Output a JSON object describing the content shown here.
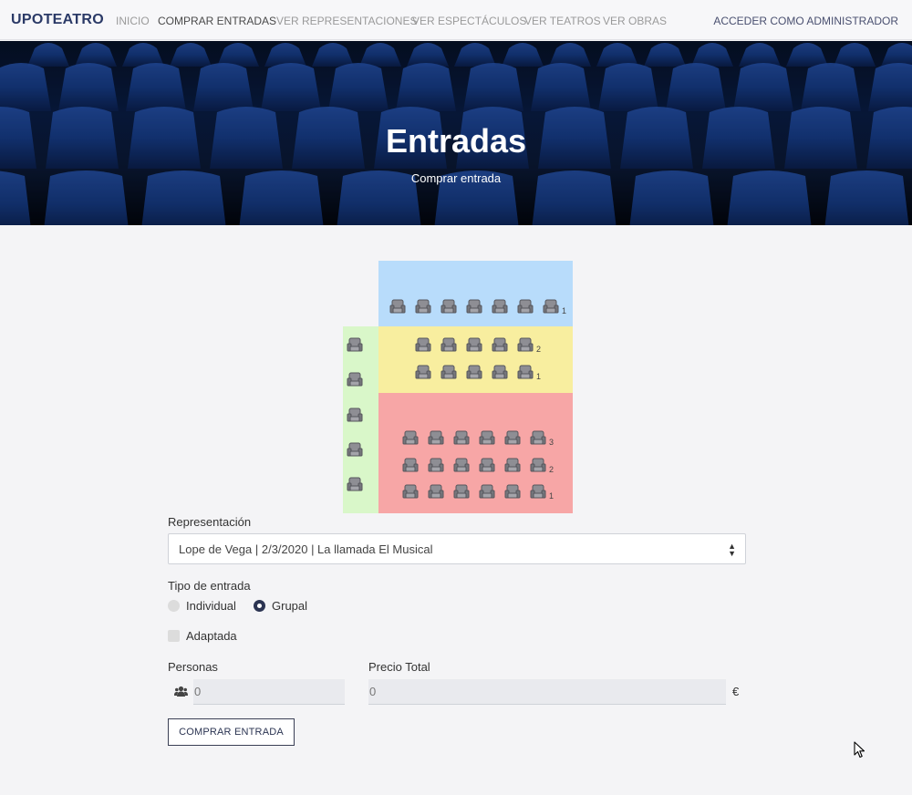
{
  "navbar": {
    "brand": "UPOTEATRO",
    "links": [
      "INICIO",
      "COMPRAR ENTRADAS",
      "VER REPRESENTACIONES",
      "VER ESPECTÁCULOS",
      "VER TEATROS",
      "VER OBRAS"
    ],
    "active_link": "COMPRAR ENTRADAS",
    "admin_link": "ACCEDER COMO ADMINISTRADOR"
  },
  "hero": {
    "title": "Entradas",
    "subtitle": "Comprar entrada"
  },
  "seat_map": {
    "zones": [
      {
        "color": "#b8dcfb",
        "rows": [
          {
            "number": "1",
            "seats": 7
          }
        ]
      },
      {
        "color": "#f8ee9f",
        "rows": [
          {
            "number": "2",
            "seats": 5
          },
          {
            "number": "1",
            "seats": 5
          }
        ]
      },
      {
        "color": "#f7a6a6",
        "rows": [
          {
            "number": "3",
            "seats": 6
          },
          {
            "number": "2",
            "seats": 6
          },
          {
            "number": "1",
            "seats": 6
          }
        ]
      },
      {
        "color": "#d9f7c9",
        "side_seats": 5
      }
    ]
  },
  "form": {
    "representacion_label": "Representación",
    "representacion_value": "Lope de Vega | 2/3/2020 | La llamada El Musical",
    "tipo_label": "Tipo de entrada",
    "tipo_options": [
      "Individual",
      "Grupal"
    ],
    "tipo_selected": "Grupal",
    "adaptada_label": "Adaptada",
    "adaptada_checked": false,
    "personas_label": "Personas",
    "personas_value": "0",
    "precio_label": "Precio Total",
    "precio_value": "0",
    "currency": "€",
    "submit_label": "COMPRAR ENTRADA"
  },
  "colors": {
    "brand": "#2b3a67",
    "accent": "#2b3452"
  },
  "icons": {
    "seat": "seat-icon",
    "personas": "users-icon",
    "select_arrow": "sort-icon",
    "cursor": "mouse-pointer-icon"
  }
}
